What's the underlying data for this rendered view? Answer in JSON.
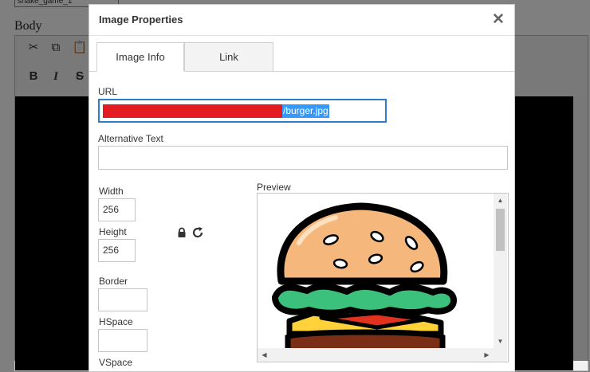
{
  "background": {
    "top_field_value": "snake_game_1",
    "body_label": "Body",
    "toolbar": {
      "cut_icon": "scissors-icon",
      "copy_icon": "copy-icon",
      "paste_icon": "paste-icon",
      "bold": "B",
      "italic": "I",
      "strike": "S"
    }
  },
  "dialog": {
    "title": "Image Properties",
    "close_glyph": "✕",
    "tabs": [
      {
        "label": "Image Info",
        "active": true
      },
      {
        "label": "Link",
        "active": false
      }
    ],
    "url": {
      "label": "URL",
      "value_visible_suffix": "/burger.jpg",
      "redacted": true,
      "redaction_color": "#e31b23"
    },
    "alt_text": {
      "label": "Alternative Text",
      "value": ""
    },
    "width": {
      "label": "Width",
      "value": "256"
    },
    "height": {
      "label": "Height",
      "value": "256"
    },
    "lock_ratio_icon": "lock-icon",
    "reset_size_icon": "reset-icon",
    "border": {
      "label": "Border",
      "value": ""
    },
    "hspace": {
      "label": "HSpace",
      "value": ""
    },
    "vspace": {
      "label": "VSpace",
      "value": ""
    },
    "preview": {
      "label": "Preview",
      "image_subject": "burger"
    }
  },
  "colors": {
    "focus_border": "#2d7cc7",
    "selection": "#3399ff",
    "overlay": "rgba(0,0,0,0.5)"
  }
}
